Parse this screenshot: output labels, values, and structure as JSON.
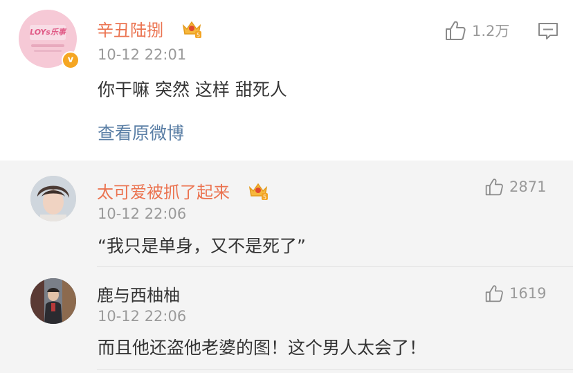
{
  "post": {
    "username": "辛丑陆捌",
    "avatar_text": "LOYs乐事",
    "verified_mark": "v",
    "time": "10-12 22:01",
    "text": "你干嘛 突然 这样 甜死人",
    "view_original": "查看原微博",
    "like_count": "1.2万"
  },
  "replies": [
    {
      "username": "太可爱被抓了起来",
      "time": "10-12 22:06",
      "text": "“我只是单身，又不是死了”",
      "like_count": "2871",
      "vip": true
    },
    {
      "username": "鹿与西柚柚",
      "time": "10-12 22:06",
      "text": "而且他还盗他老婆的图！这个男人太会了！",
      "like_count": "1619",
      "vip": false
    }
  ],
  "colors": {
    "username": "#eb7350",
    "link": "#5b7fa6",
    "meta": "#9a9a9a",
    "reply_bg": "#f4f4f4"
  },
  "icons": [
    "thumbs-up-icon",
    "comment-icon",
    "vip-crown-icon",
    "verified-badge-icon"
  ]
}
